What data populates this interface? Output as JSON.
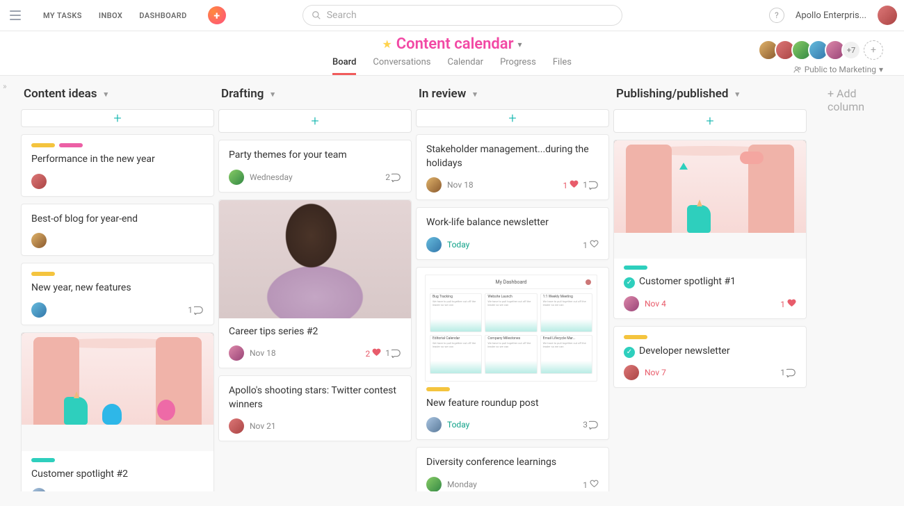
{
  "nav": {
    "my_tasks": "MY TASKS",
    "inbox": "INBOX",
    "dashboard": "DASHBOARD",
    "search_placeholder": "Search",
    "help": "?",
    "workspace": "Apollo Enterpris..."
  },
  "project": {
    "title": "Content calendar",
    "privacy": "Public to Marketing",
    "more_members": "+7",
    "tabs": {
      "board": "Board",
      "conversations": "Conversations",
      "calendar": "Calendar",
      "progress": "Progress",
      "files": "Files"
    }
  },
  "board": {
    "add_column": "+ Add column",
    "columns": [
      {
        "name": "Content ideas",
        "cards": [
          {
            "title": "Performance in the new year",
            "tag_colors": [
              "#f4c43e",
              "#ec5fa5"
            ]
          },
          {
            "title": "Best-of blog for year-end"
          },
          {
            "title": "New year, new features",
            "tag_colors": [
              "#f4c43e"
            ],
            "comments": "1"
          },
          {
            "title": "Customer spotlight #2",
            "tag_colors": [
              "#2ecfbd"
            ],
            "has_image": true,
            "image_kind": "stage-multi"
          }
        ]
      },
      {
        "name": "Drafting",
        "cards": [
          {
            "title": "Party themes for your team",
            "date": "Wednesday",
            "comments": "2"
          },
          {
            "title": "Career tips series #2",
            "date": "Nov 18",
            "likes": "2",
            "comments": "1",
            "has_image": true,
            "image_kind": "linkedin"
          },
          {
            "title": "Apollo's shooting stars: Twitter contest winners",
            "date": "Nov 21"
          }
        ]
      },
      {
        "name": "In review",
        "cards": [
          {
            "title": "Stakeholder management...during the holidays",
            "date": "Nov 18",
            "likes": "1",
            "comments": "1"
          },
          {
            "title": "Work-life balance newsletter",
            "date": "Today",
            "date_style": "today",
            "likes_empty": "1"
          },
          {
            "title": "New feature roundup post",
            "tag_colors": [
              "#f4c43e"
            ],
            "date": "Today",
            "date_style": "today",
            "comments": "3",
            "has_image": true,
            "image_kind": "dashboard"
          },
          {
            "title": "Diversity conference learnings",
            "date": "Monday",
            "likes_empty": "1"
          }
        ]
      },
      {
        "name": "Publishing/published",
        "cards": [
          {
            "title": "Customer spotlight #1",
            "tag_colors": [
              "#2ecfbd"
            ],
            "completed": true,
            "date": "Nov 4",
            "date_style": "red",
            "likes": "1",
            "has_image": true,
            "image_kind": "stage-single"
          },
          {
            "title": "Developer newsletter",
            "tag_colors": [
              "#f4c43e"
            ],
            "completed": true,
            "date": "Nov 7",
            "date_style": "red",
            "comments": "1"
          }
        ]
      }
    ]
  },
  "dashboard_thumb": {
    "title": "My Dashboard",
    "cells": [
      "Bug Tracking",
      "Website Launch",
      "1:1 Weekly Meeting",
      "Editorial Calendar",
      "Company Milestones",
      "Email Lifecycle Mar..."
    ]
  }
}
